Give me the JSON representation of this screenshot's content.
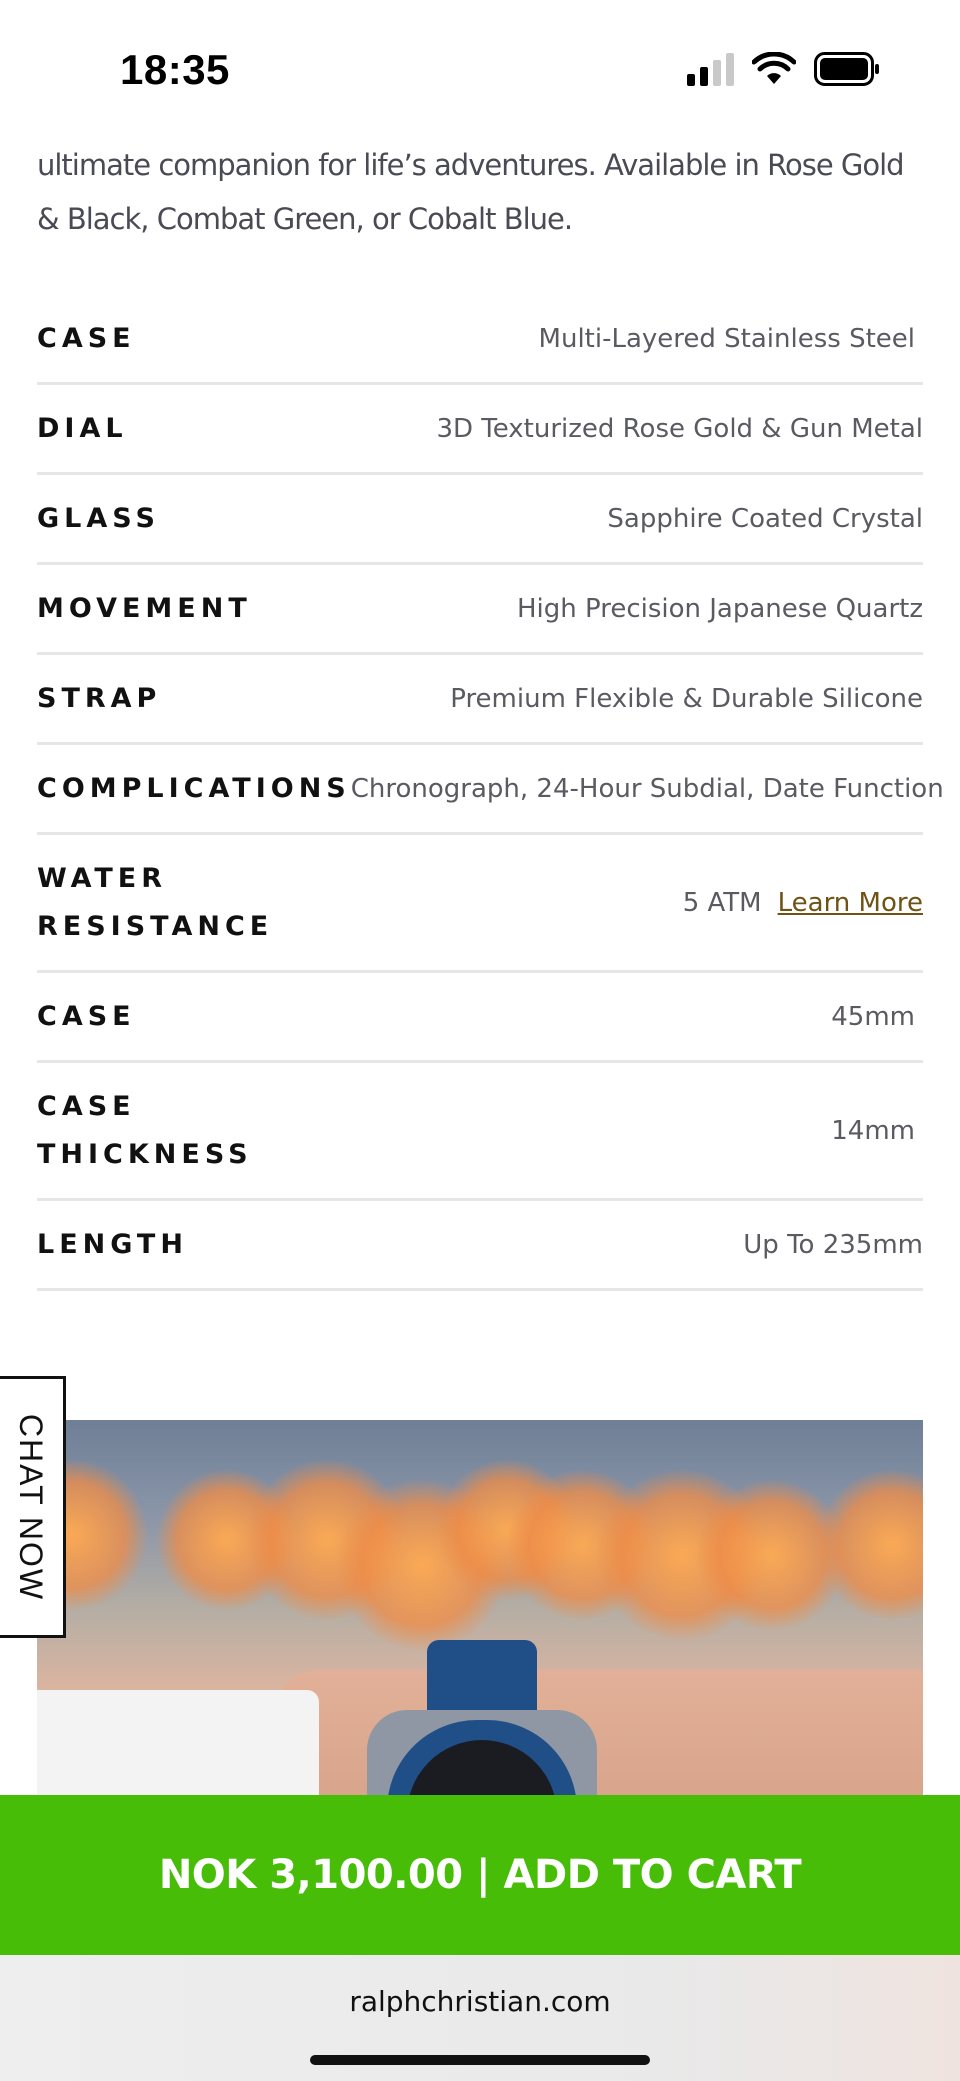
{
  "status_bar": {
    "time": "18:35",
    "icons": [
      "cellular-signal-icon",
      "wifi-icon",
      "battery-icon"
    ]
  },
  "description": {
    "text": "ultimate companion for life’s adventures. Available in Rose Gold & Black, Combat Green, or Cobalt Blue."
  },
  "specs": [
    {
      "label": "CASE",
      "value": "Multi-Layered Stainless Steel"
    },
    {
      "label": "DIAL",
      "value": "3D Texturized Rose Gold & Gun Metal"
    },
    {
      "label": "GLASS",
      "value": "Sapphire Coated Crystal"
    },
    {
      "label": "MOVEMENT",
      "value": "High Precision Japanese Quartz"
    },
    {
      "label": "STRAP",
      "value": "Premium Flexible & Durable Silicone"
    },
    {
      "label": "COMPLICATIONS",
      "value": "Chronograph, 24-Hour Subdial, Date Function"
    },
    {
      "label": "WATER RESISTANCE",
      "value": "5 ATM",
      "link": "Learn More"
    },
    {
      "label": "CASE",
      "value": "45mm"
    },
    {
      "label": "CASE THICKNESS",
      "value": "14mm"
    },
    {
      "label": "LENGTH",
      "value": "Up To 235mm"
    }
  ],
  "chat": {
    "label": "CHAT NOW"
  },
  "cart": {
    "label": "NOK 3,100.00 | ADD TO CART",
    "color": "#47bd08"
  },
  "browser": {
    "url": "ralphchristian.com"
  },
  "colors": {
    "link": "#6e5314",
    "text_muted": "#5a5a62"
  }
}
